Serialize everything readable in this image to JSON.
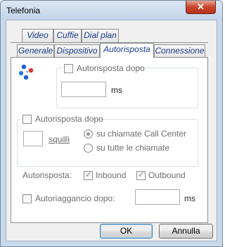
{
  "window": {
    "title": "Telefonia",
    "close_glyph": "✕"
  },
  "tabs_back": [
    {
      "label": "Video"
    },
    {
      "label": "Cuffie"
    },
    {
      "label": "Dial plan"
    }
  ],
  "tabs_front": [
    {
      "label": "Generale"
    },
    {
      "label": "Dispositivo"
    },
    {
      "label": "Autorisposta"
    },
    {
      "label": "Connessione"
    }
  ],
  "panel": {
    "icon": "users-network-icon",
    "autoanswer_delay": {
      "label": "Autorisposta dopo",
      "checked": false,
      "value": "",
      "unit": "ms"
    },
    "rings_group": {
      "label": "Autorisposta dopo",
      "checked": false,
      "rings_value": "",
      "rings_unit": "squilli",
      "options": [
        {
          "label": "su chiamate Call Center",
          "selected": true
        },
        {
          "label": "su tutte le chiamate",
          "selected": false
        }
      ]
    },
    "autoanswer_row": {
      "label": "Autorisposta:",
      "inbound": {
        "label": "Inbound",
        "checked": true
      },
      "outbound": {
        "label": "Outbound",
        "checked": true
      }
    },
    "autohangup": {
      "label": "Autoriaggancio dopo:",
      "checked": false,
      "value": "",
      "unit": "ms"
    }
  },
  "buttons": {
    "ok": "OK",
    "cancel": "Annulla"
  }
}
